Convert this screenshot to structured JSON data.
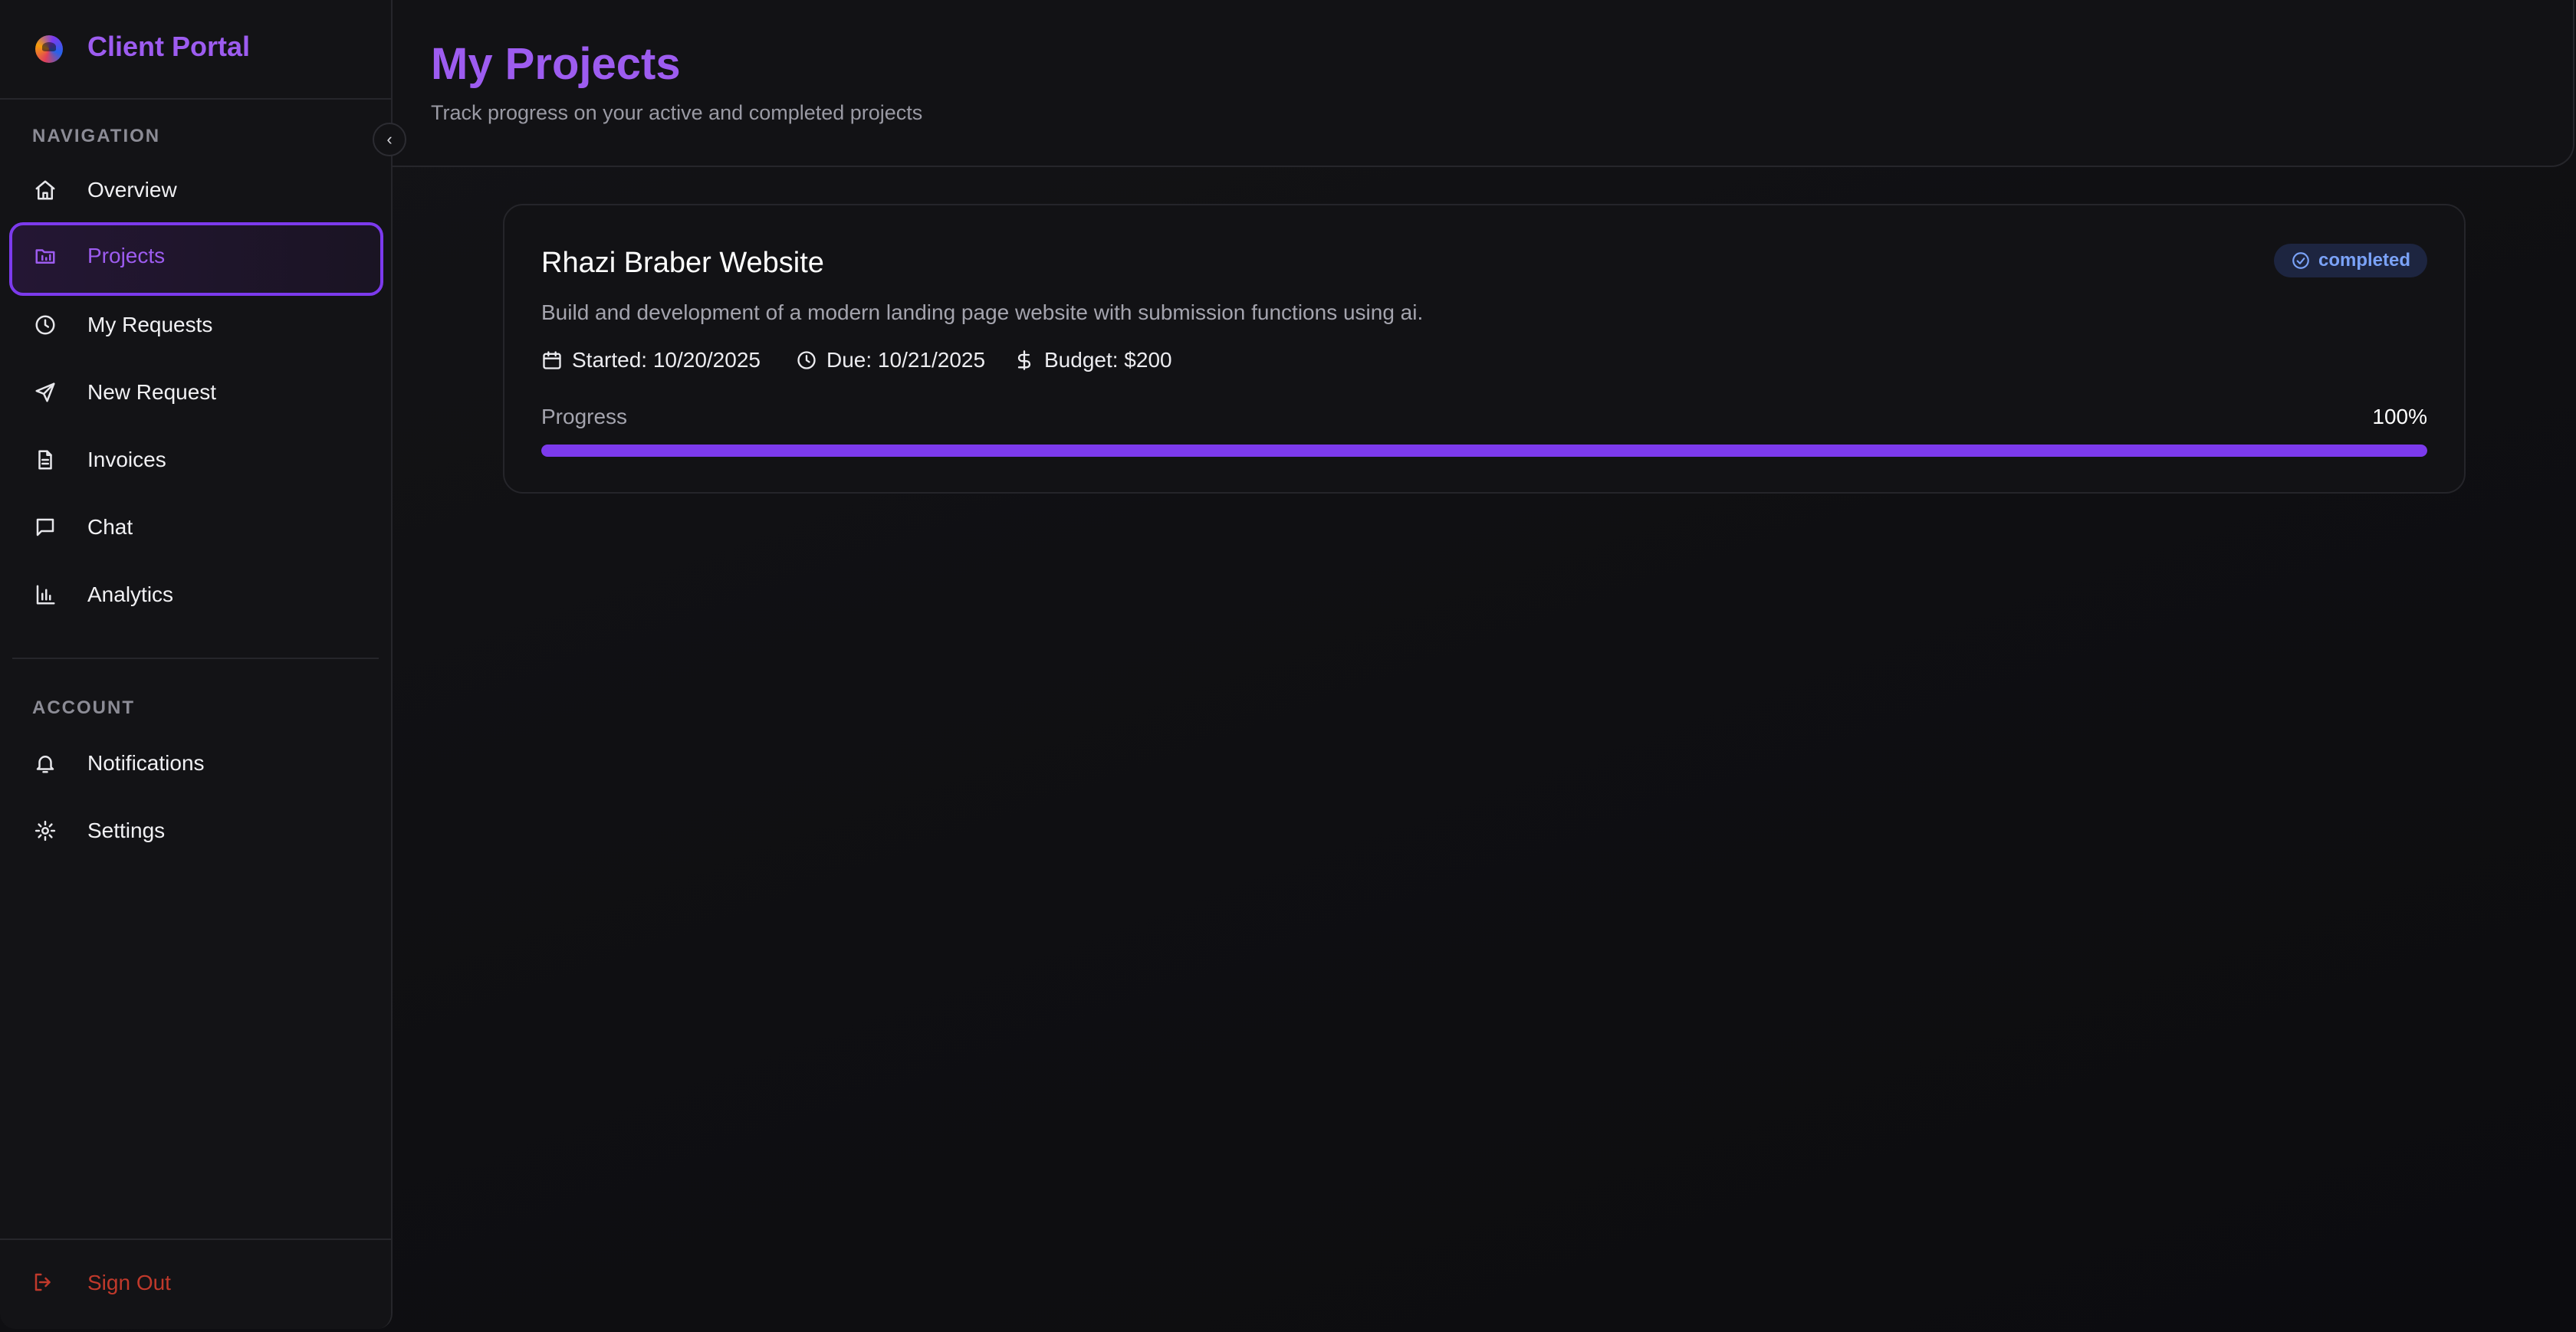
{
  "app": {
    "name": "Client Portal"
  },
  "sidebar": {
    "nav_heading": "NAVIGATION",
    "account_heading": "ACCOUNT",
    "nav_items": [
      {
        "label": "Overview",
        "icon": "home-icon"
      },
      {
        "label": "Projects",
        "icon": "folder-icon",
        "active": true
      },
      {
        "label": "My Requests",
        "icon": "clock-icon"
      },
      {
        "label": "New Request",
        "icon": "send-icon"
      },
      {
        "label": "Invoices",
        "icon": "document-icon"
      },
      {
        "label": "Chat",
        "icon": "chat-icon"
      },
      {
        "label": "Analytics",
        "icon": "bar-chart-icon"
      }
    ],
    "account_items": [
      {
        "label": "Notifications",
        "icon": "bell-icon"
      },
      {
        "label": "Settings",
        "icon": "gear-icon"
      }
    ],
    "sign_out": "Sign Out"
  },
  "header": {
    "title": "My Projects",
    "subtitle": "Track progress on your active and completed projects"
  },
  "projects": [
    {
      "title": "Rhazi Braber Website",
      "status": "completed",
      "description": "Build and development of a modern landing page website with submission functions using ai.",
      "started": "Started: 10/20/2025",
      "due": "Due: 10/21/2025",
      "budget": "Budget: $200",
      "progress_label": "Progress",
      "progress_text": "100%",
      "progress": 100
    }
  ],
  "colors": {
    "accent": "#7c3aed",
    "accent_text": "#9d5cf0",
    "status_badge_bg": "#1d2540",
    "status_badge_text": "#7aa2f7",
    "danger": "#c0392b"
  }
}
